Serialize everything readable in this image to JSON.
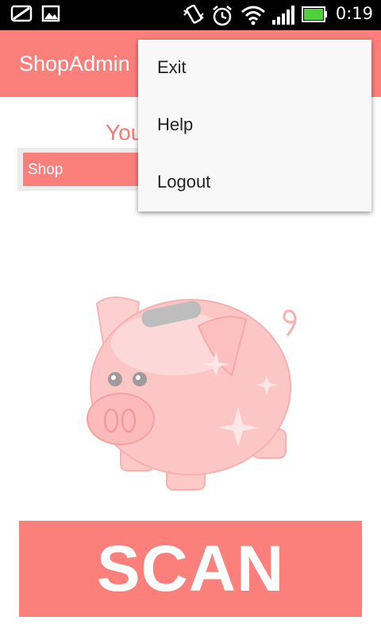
{
  "status_bar": {
    "time": "0:19",
    "icons": [
      "notification-icon",
      "picture-icon",
      "vibrate-icon",
      "alarm-icon",
      "wifi-icon",
      "signal-icon",
      "battery-icon"
    ]
  },
  "action_bar": {
    "title": "ShopAdmin"
  },
  "main": {
    "welcome_partial": "You",
    "spinner_value": "Shop",
    "scan_label": "SCAN",
    "illustration": "piggy-bank-icon"
  },
  "menu": {
    "items": [
      {
        "label": "Exit"
      },
      {
        "label": "Help"
      },
      {
        "label": "Logout"
      }
    ]
  },
  "colors": {
    "accent": "#fb807c",
    "status_bar": "#000000",
    "menu_bg": "#f8f8f8"
  }
}
